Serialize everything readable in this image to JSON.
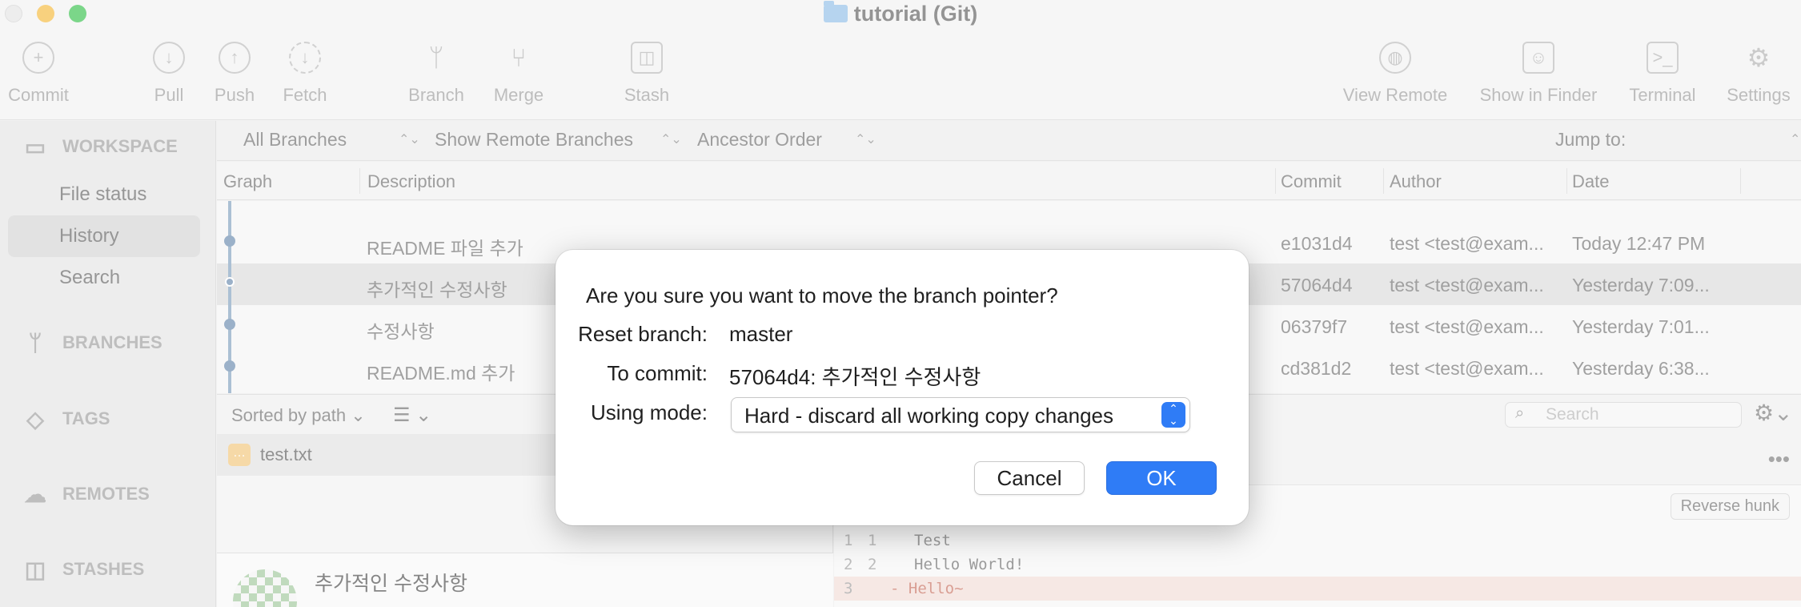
{
  "window": {
    "title": "tutorial (Git)",
    "folder_icon": "folder-icon"
  },
  "toolbar": {
    "commit": "Commit",
    "pull": "Pull",
    "push": "Push",
    "fetch": "Fetch",
    "branch": "Branch",
    "merge": "Merge",
    "stash": "Stash",
    "view_remote": "View Remote",
    "show_in_finder": "Show in Finder",
    "terminal": "Terminal",
    "settings": "Settings"
  },
  "sidebar": {
    "workspace": "WORKSPACE",
    "items": [
      {
        "label": "File status"
      },
      {
        "label": "History"
      },
      {
        "label": "Search"
      }
    ],
    "branches": "BRANCHES",
    "tags": "TAGS",
    "remotes": "REMOTES",
    "stashes": "STASHES"
  },
  "filters": {
    "branches": "All Branches",
    "remote": "Show Remote Branches",
    "order": "Ancestor Order",
    "jump_to": "Jump to:"
  },
  "columns": {
    "graph": "Graph",
    "description": "Description",
    "commit": "Commit",
    "author": "Author",
    "date": "Date"
  },
  "commits": [
    {
      "description": "README 파일 추가",
      "hash": "e1031d4",
      "author": "test <test@exam...",
      "date": "Today 12:47 PM"
    },
    {
      "description": "추가적인 수정사항",
      "hash": "57064d4",
      "author": "test <test@exam...",
      "date": "Yesterday 7:09..."
    },
    {
      "description": "수정사항",
      "hash": "06379f7",
      "author": "test <test@exam...",
      "date": "Yesterday 7:01..."
    },
    {
      "description": "README.md 추가",
      "hash": "cd381d2",
      "author": "test <test@exam...",
      "date": "Yesterday 6:38..."
    }
  ],
  "lower": {
    "sort": "Sorted by path",
    "search_placeholder": "Search",
    "file": "test.txt",
    "commit_title": "추가적인 수정사항",
    "reverse_hunk": "Reverse hunk"
  },
  "diff_lines": [
    {
      "old": "1",
      "new": "1",
      "text": "Test"
    },
    {
      "old": "2",
      "new": "2",
      "text": "Hello World!"
    },
    {
      "old": "3",
      "new": "",
      "text": "- Hello~"
    }
  ],
  "dialog": {
    "question": "Are you sure you want to move the branch pointer?",
    "reset_label": "Reset branch:",
    "reset_value": "master",
    "commit_label": "To commit:",
    "commit_value": "57064d4: 추가적인 수정사항",
    "mode_label": "Using mode:",
    "mode_value": "Hard - discard all working copy changes",
    "cancel": "Cancel",
    "ok": "OK"
  },
  "colors": {
    "accent": "#2f7cf6",
    "graph": "#6688ac"
  }
}
